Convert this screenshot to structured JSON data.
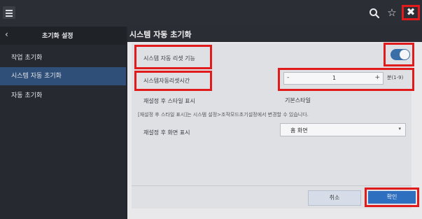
{
  "topbar": {
    "icons": [
      "menu-icon",
      "search-icon",
      "star-icon",
      "close-icon"
    ],
    "star_glyph": "☆",
    "close_glyph": "✖"
  },
  "sidebar": {
    "back_glyph": "‹",
    "title": "초기화 설정",
    "items": [
      {
        "label": "작업 초기화",
        "active": false
      },
      {
        "label": "시스템 자동 초기화",
        "active": true
      },
      {
        "label": "자동 초기화",
        "active": false
      }
    ]
  },
  "main": {
    "title": "시스템 자동 초기화",
    "auto_reset_label": "시스템 자동 리셋 기능",
    "auto_reset_on": true,
    "reset_time_label": "시스템자동리셋시간",
    "reset_time_minus": "-",
    "reset_time_value": "1",
    "reset_time_plus": "+",
    "reset_time_unit": "분(1-9)",
    "style_label": "재설정 후 스타일 표시",
    "style_value": "기본스타일",
    "notice": "[재설정 후 스타일 표시]는 시스템 설정>조작모드초기설정에서 변경할 수 있습니다.",
    "screen_label": "재설정 후 화면 표시",
    "screen_value": "홈 화면",
    "screen_caret": "▾"
  },
  "footer": {
    "cancel_label": "취소",
    "ok_label": "확인"
  },
  "colors": {
    "highlight": "#e11b1b",
    "accent": "#2e6fc0",
    "sidebar_active": "#2f4e78"
  }
}
